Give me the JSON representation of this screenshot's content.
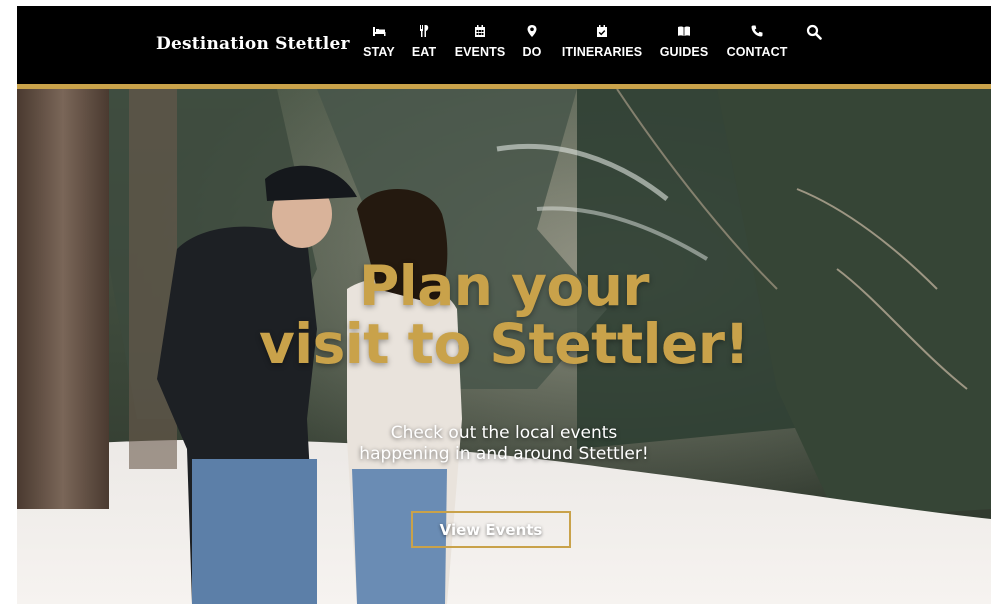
{
  "brand": {
    "name": "Destination Stettler"
  },
  "nav": {
    "items": [
      {
        "label": "STAY",
        "icon": "bed-icon"
      },
      {
        "label": "EAT",
        "icon": "utensils-icon"
      },
      {
        "label": "EVENTS",
        "icon": "calendar-icon"
      },
      {
        "label": "DO",
        "icon": "map-pin-icon"
      },
      {
        "label": "ITINERARIES",
        "icon": "calendar-check-icon"
      },
      {
        "label": "GUIDES",
        "icon": "book-open-icon"
      },
      {
        "label": "CONTACT",
        "icon": "phone-icon"
      }
    ],
    "search_icon": "search-icon"
  },
  "hero": {
    "title_line1": "Plan your",
    "title_line2": "visit to Stettler!",
    "subtitle_line1": "Check out the local events",
    "subtitle_line2": "happening in and around Stettler!",
    "cta_label": "View Events"
  },
  "colors": {
    "header_bg": "#000000",
    "accent_gold": "#c9a24a",
    "text_white": "#ffffff"
  }
}
